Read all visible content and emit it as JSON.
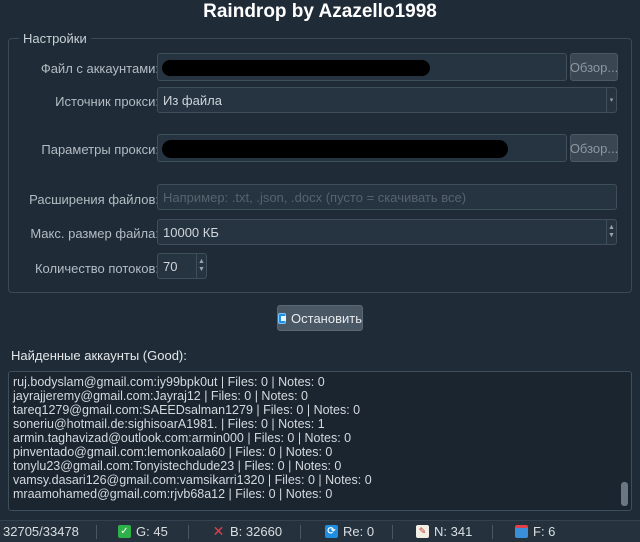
{
  "app": {
    "title": "Raindrop by Azazello1998"
  },
  "settings": {
    "group_title": "Настройки",
    "accounts_file": {
      "label": "Файл с аккаунтами:",
      "browse": "Обзор..."
    },
    "proxy_source": {
      "label": "Источник прокси:",
      "value": "Из файла"
    },
    "proxy_params": {
      "label": "Параметры прокси:",
      "browse": "Обзор..."
    },
    "extensions": {
      "label": "Расширения файлов:",
      "placeholder": "Например: .txt, .json, .docx (пусто = скачивать все)"
    },
    "max_size": {
      "label": "Макс. размер файла:",
      "value": "10000 КБ"
    },
    "threads": {
      "label": "Количество потоков:",
      "value": "70"
    }
  },
  "stop_button": {
    "label": "Остановить"
  },
  "found": {
    "label": "Найденные аккаунты (Good):",
    "lines": [
      "ruj.bodyslam@gmail.com:iy99bpk0ut | Files: 0 | Notes: 0",
      "jayrajjeremy@gmail.com:Jayraj12 | Files: 0 | Notes: 0",
      "tareq1279@gmail.com:SAEEDsalman1279 | Files: 0 | Notes: 0",
      "soneriu@hotmail.de:sighisoarA1981. | Files: 0 | Notes: 1",
      "armin.taghavizad@outlook.com:armin000 | Files: 0 | Notes: 0",
      "pinventado@gmail.com:lemonkoala60 | Files: 0 | Notes: 0",
      "tonylu23@gmail.com:Tonyistechdude23 | Files: 0 | Notes: 0",
      "vamsy.dasari126@gmail.com:vamsikarri1320 | Files: 0 | Notes: 0",
      "mraamohamed@gmail.com:rjvb68a12 | Files: 0 | Notes: 0"
    ]
  },
  "status": {
    "progress": "32705/33478",
    "good": "G: 45",
    "bad": "B: 32660",
    "retry": "Re: 0",
    "notes": "N: 341",
    "files": "F: 6"
  },
  "colors": {
    "background": "#1f2b36",
    "good": "#2fb14a",
    "bad": "#e0404a",
    "retry": "#1d8ee0"
  },
  "icons": {
    "good": "check-icon",
    "bad": "cross-icon",
    "retry": "refresh-icon",
    "notes": "note-icon",
    "files": "file-icon",
    "stop": "stop-icon"
  }
}
